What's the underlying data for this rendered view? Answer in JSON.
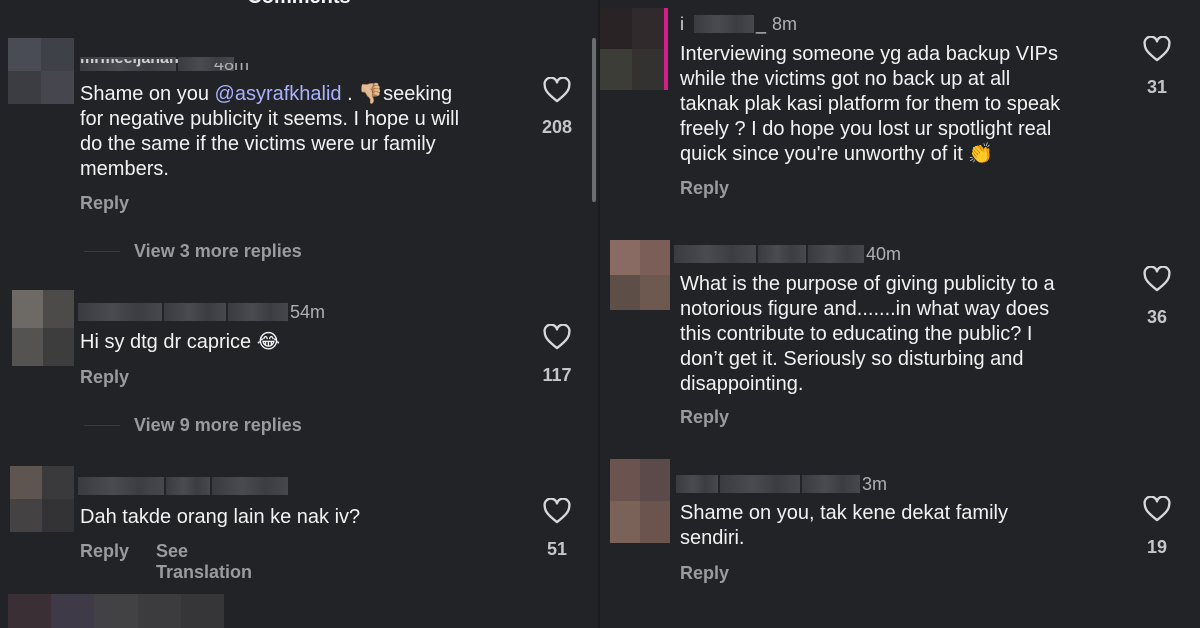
{
  "header": {
    "title": "Comments"
  },
  "reply_label": "Reply",
  "see_translation_label": "See Translation",
  "colors": {
    "background": "#222326",
    "text": "#f2f2f2",
    "muted": "#9a9b9f",
    "mention": "#a9b2ff",
    "story_ring": "#d21d8a"
  },
  "left_comments": [
    {
      "username": "mrmeeijanan",
      "time": "48m",
      "text_lines": [
        "Shame on you ",
        "@asyrafkhalid",
        " . ",
        "👎🏼",
        "seeking",
        "for negative publicity it seems. I hope u will",
        "do the same if the victims were ur family",
        "members."
      ],
      "likes": "208",
      "more_replies": "View 3 more replies"
    },
    {
      "time": "54m",
      "text": "Hi sy dtg dr caprice",
      "emoji": "😂",
      "likes": "117",
      "more_replies": "View 9 more replies"
    },
    {
      "text": "Dah takde orang lain ke nak iv?",
      "likes": "51"
    }
  ],
  "right_comments": [
    {
      "username_initial": "i",
      "username_tail": "_",
      "time": "8m",
      "text_lines": [
        "Interviewing someone yg ada backup VIPs",
        "while the victims got no back up at all",
        "taknak plak kasi platform for them to speak",
        "freely ? I do hope you lost ur spotlight real",
        "quick since you're unworthy of it"
      ],
      "emoji": "👏",
      "likes": "31"
    },
    {
      "time": "40m",
      "text_lines": [
        "What is the purpose of giving publicity to a",
        "notorious figure and.......in what way does",
        "this contribute to educating the public? I",
        "don’t get it. Seriously so disturbing and",
        "disappointing."
      ],
      "likes": "36"
    },
    {
      "time": "3m",
      "text_lines": [
        "Shame on you, tak kene dekat family",
        "sendiri."
      ],
      "likes": "19"
    }
  ]
}
